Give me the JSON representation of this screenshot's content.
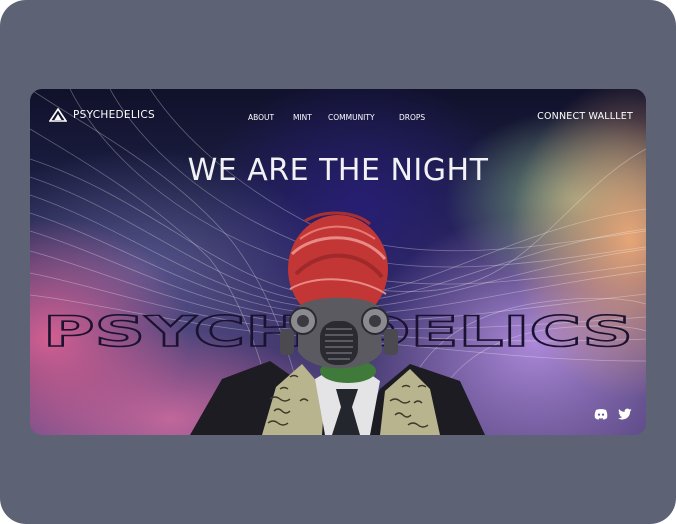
{
  "brand": {
    "name": "PSYCHEDELICS"
  },
  "nav": {
    "items": [
      {
        "id": "about",
        "label": "ABOUT"
      },
      {
        "id": "mint",
        "label": "MINT"
      },
      {
        "id": "community",
        "label": "COMMUNITY"
      },
      {
        "id": "drops",
        "label": "DROPS"
      }
    ],
    "connect_label": "CONNECT WALLLET"
  },
  "hero": {
    "headline": "WE ARE THE NIGHT",
    "outline_word": "PSYCHEDELICS"
  },
  "social": {
    "icons": [
      "discord-icon",
      "twitter-icon"
    ]
  },
  "colors": {
    "frame": "#5e6275",
    "hero_top": "#10112a",
    "text": "#ffffff",
    "mask_red": "#c63a3a",
    "suit": "#1e1e24"
  }
}
